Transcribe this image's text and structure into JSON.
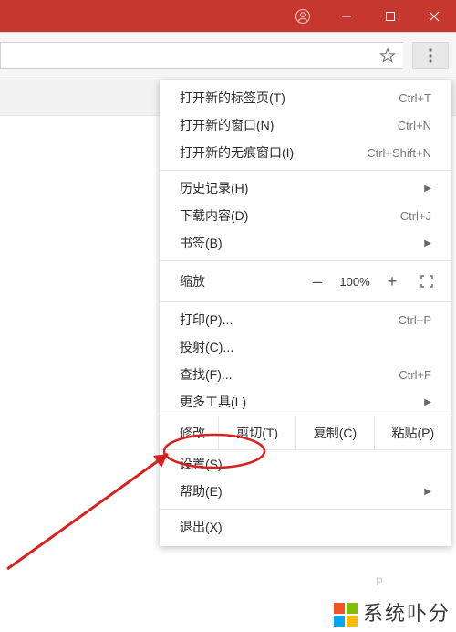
{
  "titlebar": {
    "account_icon": "account-icon",
    "minimize_icon": "minimize-icon",
    "maximize_icon": "maximize-icon",
    "close_icon": "close-icon"
  },
  "addrbar": {
    "star_icon": "star-icon",
    "menu_icon": "more-vert-icon"
  },
  "menu": {
    "new_tab": {
      "label": "打开新的标签页(T)",
      "shortcut": "Ctrl+T"
    },
    "new_window": {
      "label": "打开新的窗口(N)",
      "shortcut": "Ctrl+N"
    },
    "incognito": {
      "label": "打开新的无痕窗口(I)",
      "shortcut": "Ctrl+Shift+N"
    },
    "history": {
      "label": "历史记录(H)"
    },
    "downloads": {
      "label": "下载内容(D)",
      "shortcut": "Ctrl+J"
    },
    "bookmarks": {
      "label": "书签(B)"
    },
    "zoom": {
      "label": "缩放",
      "minus": "–",
      "value": "100%",
      "plus": "+"
    },
    "print": {
      "label": "打印(P)...",
      "shortcut": "Ctrl+P"
    },
    "cast": {
      "label": "投射(C)..."
    },
    "find": {
      "label": "查找(F)...",
      "shortcut": "Ctrl+F"
    },
    "more_tools": {
      "label": "更多工具(L)"
    },
    "edit": {
      "label": "修改",
      "cut": "剪切(T)",
      "copy": "复制(C)",
      "paste": "粘贴(P)"
    },
    "settings": {
      "label": "设置(S)"
    },
    "help": {
      "label": "帮助(E)"
    },
    "exit": {
      "label": "退出(X)"
    }
  },
  "watermark": {
    "p": "P",
    "text": "系统卟分"
  }
}
